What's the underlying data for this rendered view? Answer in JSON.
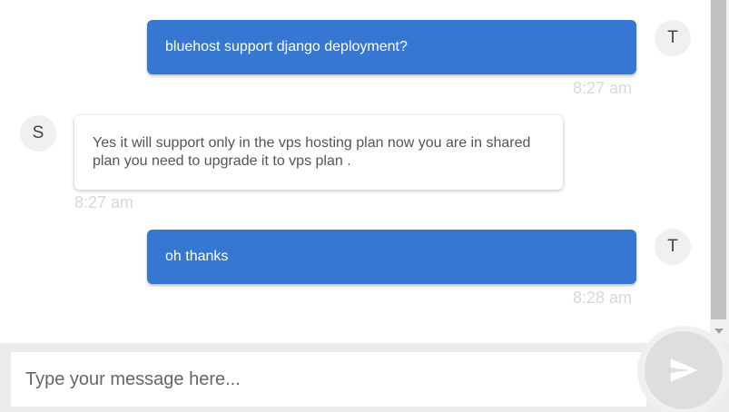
{
  "messages": [
    {
      "sender": "user",
      "avatar": "T",
      "text": "bluehost support django deployment?",
      "time": "8:27 am"
    },
    {
      "sender": "support",
      "avatar": "S",
      "text": "Yes it will support only in the vps hosting plan now you are in shared plan you need to upgrade it to vps plan .",
      "time": "8:27 am"
    },
    {
      "sender": "user",
      "avatar": "T",
      "text": "oh thanks",
      "time": "8:28 am"
    }
  ],
  "composer": {
    "placeholder": "Type your message here...",
    "value": "",
    "send_icon": "send-icon"
  },
  "colors": {
    "outgoing_bubble": "#3677d2",
    "incoming_bubble": "#ffffff",
    "timestamp": "#d8d8d8",
    "avatar_bg": "#f0f0f0"
  }
}
